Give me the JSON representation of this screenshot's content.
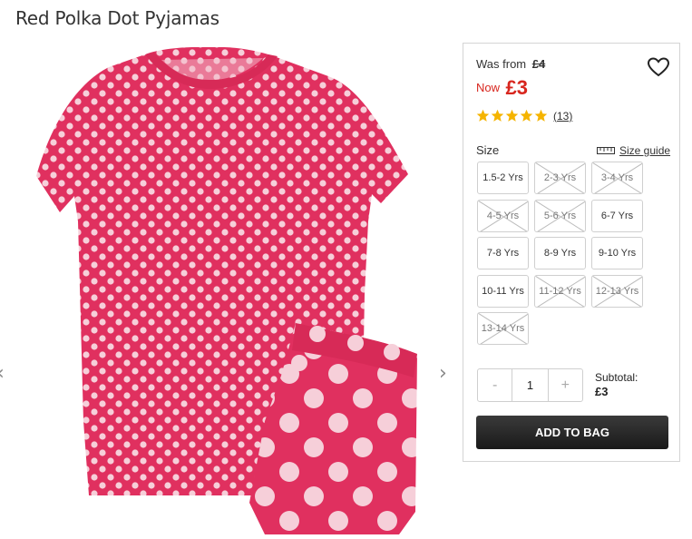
{
  "product": {
    "title": "Red Polka Dot Pyjamas"
  },
  "gallery": {
    "prev_icon": "chevron-left-icon",
    "next_icon": "chevron-right-icon"
  },
  "price": {
    "was_label": "Was from",
    "was_price": "£4",
    "now_label": "Now",
    "now_price": "£3",
    "accent_color": "#d8261e"
  },
  "rating": {
    "stars": 5,
    "max": 5,
    "reviews": "(13)",
    "star_color": "#f5b400"
  },
  "size": {
    "label": "Size",
    "guide_label": "Size guide",
    "options": [
      {
        "label": "1.5-2 Yrs",
        "available": true
      },
      {
        "label": "2-3 Yrs",
        "available": false
      },
      {
        "label": "3-4 Yrs",
        "available": false
      },
      {
        "label": "4-5 Yrs",
        "available": false
      },
      {
        "label": "5-6 Yrs",
        "available": false
      },
      {
        "label": "6-7 Yrs",
        "available": true
      },
      {
        "label": "7-8 Yrs",
        "available": true
      },
      {
        "label": "8-9 Yrs",
        "available": true
      },
      {
        "label": "9-10 Yrs",
        "available": true
      },
      {
        "label": "10-11 Yrs",
        "available": true
      },
      {
        "label": "11-12 Yrs",
        "available": false
      },
      {
        "label": "12-13 Yrs",
        "available": false
      },
      {
        "label": "13-14 Yrs",
        "available": false
      }
    ]
  },
  "quantity": {
    "minus": "-",
    "value": "1",
    "plus": "+"
  },
  "subtotal": {
    "label": "Subtotal:",
    "value": "£3"
  },
  "cta": {
    "add_label": "ADD TO BAG"
  },
  "colors": {
    "garment": "#e0305f",
    "dots": "#f6cfd9"
  }
}
